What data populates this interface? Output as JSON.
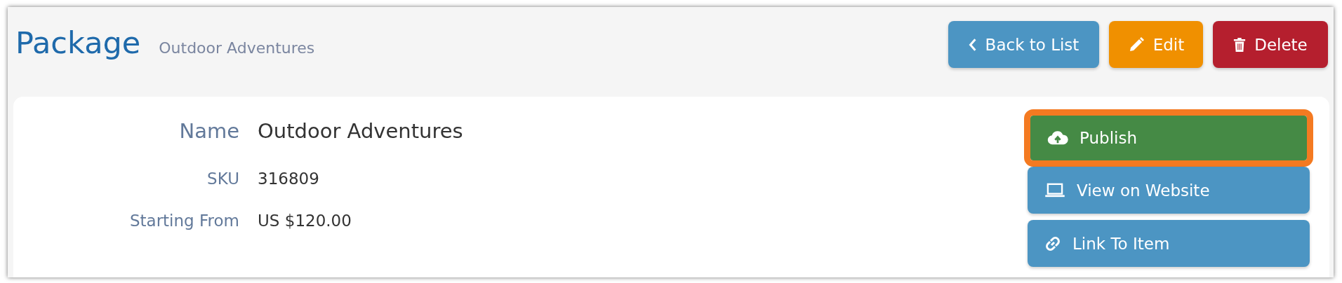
{
  "header": {
    "title": "Package",
    "subtitle": "Outdoor Adventures"
  },
  "header_buttons": [
    {
      "label": "Back to List",
      "kind": "back"
    },
    {
      "label": "Edit",
      "kind": "edit"
    },
    {
      "label": "Delete",
      "kind": "delete"
    }
  ],
  "fields": [
    {
      "label": "Name",
      "value": "Outdoor Adventures",
      "kind": "large"
    },
    {
      "label": "SKU",
      "value": "316809",
      "kind": "normal"
    },
    {
      "label": "Starting From",
      "value": "US $120.00",
      "kind": "normal"
    }
  ],
  "actions": [
    {
      "label": "Publish",
      "kind": "publish",
      "highlighted": true
    },
    {
      "label": "View on Website",
      "kind": "view",
      "highlighted": false
    },
    {
      "label": "Link To Item",
      "kind": "link",
      "highlighted": false
    }
  ]
}
